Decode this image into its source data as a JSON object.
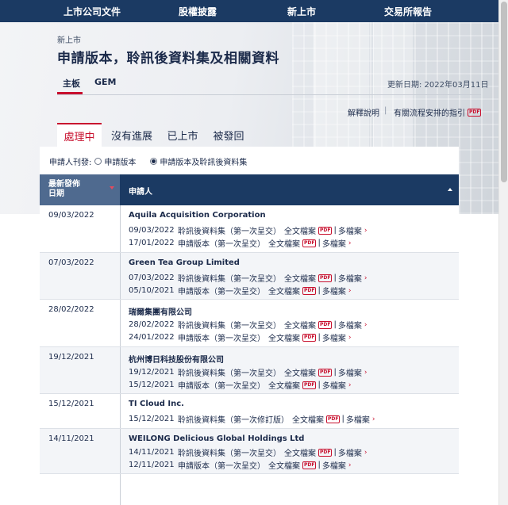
{
  "topnav": [
    "上市公司文件",
    "股權披露",
    "新上市",
    "交易所報告"
  ],
  "breadcrumb": "新上市",
  "page_title": "申請版本，聆訊後資料集及相關資料",
  "board_tabs": [
    "主板",
    "GEM"
  ],
  "updated_date": "更新日期: 2022年03月11日",
  "links": {
    "explain": "解釋說明",
    "separator": "|",
    "guide": "有關流程安排的指引",
    "pdf": "PDF"
  },
  "status_tabs": [
    "處理中",
    "沒有進展",
    "已上市",
    "被發回"
  ],
  "filter": {
    "label": "申請人刊發:",
    "option1": "申請版本",
    "option2": "申請版本及聆訊後資料集",
    "selected": "申請版本及聆訊後資料集"
  },
  "table_header": {
    "date_line1": "最新發佈",
    "date_line2": "日期",
    "applicant": "申請人"
  },
  "rows": [
    {
      "date": "09/03/2022",
      "company": "Aquila Acquisition Corporation",
      "filings": [
        {
          "date": "09/03/2022",
          "type": "聆訊後資料集（第一次呈交）",
          "full": "全文檔案",
          "pdf": "PDF",
          "multi": "多檔案",
          "chev": "›"
        },
        {
          "date": "17/01/2022",
          "type": "申請版本（第一次呈交）",
          "full": "全文檔案",
          "pdf": "PDF",
          "multi": "多檔案",
          "chev": "›"
        }
      ]
    },
    {
      "date": "07/03/2022",
      "company": "Green Tea Group Limited",
      "filings": [
        {
          "date": "07/03/2022",
          "type": "聆訊後資料集（第一次呈交）",
          "full": "全文檔案",
          "pdf": "PDF",
          "multi": "多檔案",
          "chev": "›"
        },
        {
          "date": "05/10/2021",
          "type": "申請版本（第一次呈交）",
          "full": "全文檔案",
          "pdf": "PDF",
          "multi": "多檔案",
          "chev": "›"
        }
      ]
    },
    {
      "date": "28/02/2022",
      "company": "瑞爾集團有限公司",
      "filings": [
        {
          "date": "28/02/2022",
          "type": "聆訊後資料集（第一次呈交）",
          "full": "全文檔案",
          "pdf": "PDF",
          "multi": "多檔案",
          "chev": "›"
        },
        {
          "date": "24/01/2022",
          "type": "申請版本（第一次呈交）",
          "full": "全文檔案",
          "pdf": "PDF",
          "multi": "多檔案",
          "chev": "›"
        }
      ]
    },
    {
      "date": "19/12/2021",
      "company": "杭州博日科技股份有限公司",
      "filings": [
        {
          "date": "19/12/2021",
          "type": "聆訊後資料集（第一次呈交）",
          "full": "全文檔案",
          "pdf": "PDF",
          "multi": "多檔案",
          "chev": "›"
        },
        {
          "date": "15/12/2021",
          "type": "申請版本（第一次呈交）",
          "full": "全文檔案",
          "pdf": "PDF",
          "multi": "多檔案",
          "chev": "›"
        }
      ]
    },
    {
      "date": "15/12/2021",
      "company": "TI Cloud Inc.",
      "filings": [
        {
          "date": "15/12/2021",
          "type": "聆訊後資料集（第一次修訂版）",
          "full": "全文檔案",
          "pdf": "PDF",
          "multi": "多檔案",
          "chev": "›"
        }
      ]
    },
    {
      "date": "14/11/2021",
      "company": "WEILONG Delicious Global Holdings Ltd",
      "filings": [
        {
          "date": "14/11/2021",
          "type": "聆訊後資料集（第一次呈交）",
          "full": "全文檔案",
          "pdf": "PDF",
          "multi": "多檔案",
          "chev": "›"
        },
        {
          "date": "12/11/2021",
          "type": "申請版本（第一次呈交）",
          "full": "全文檔案",
          "pdf": "PDF",
          "multi": "多檔案",
          "chev": "›"
        }
      ]
    }
  ],
  "colors": {
    "navy": "#1b3a63",
    "accent_red": "#c8102e",
    "header_date_bg": "#4f6a8f",
    "row_shade": "#f3f5f8"
  }
}
